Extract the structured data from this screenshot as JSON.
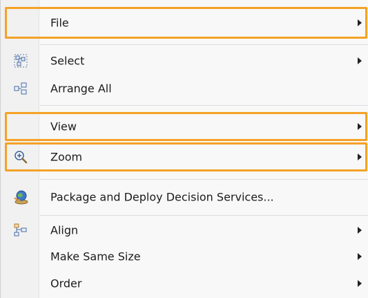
{
  "menu": {
    "items": [
      {
        "label": "File"
      },
      {
        "label": "Select"
      },
      {
        "label": "Arrange All"
      },
      {
        "label": "View"
      },
      {
        "label": "Zoom"
      },
      {
        "label": "Package and Deploy Decision Services..."
      },
      {
        "label": "Align"
      },
      {
        "label": "Make Same Size"
      },
      {
        "label": "Order"
      }
    ]
  },
  "colors": {
    "highlight": "#f4a226",
    "background": "#f8f8f8",
    "gutter": "#f1f1f1"
  },
  "icons": [
    "select-icon",
    "arrange-all-icon",
    "zoom-icon",
    "deploy-icon",
    "align-icon"
  ]
}
